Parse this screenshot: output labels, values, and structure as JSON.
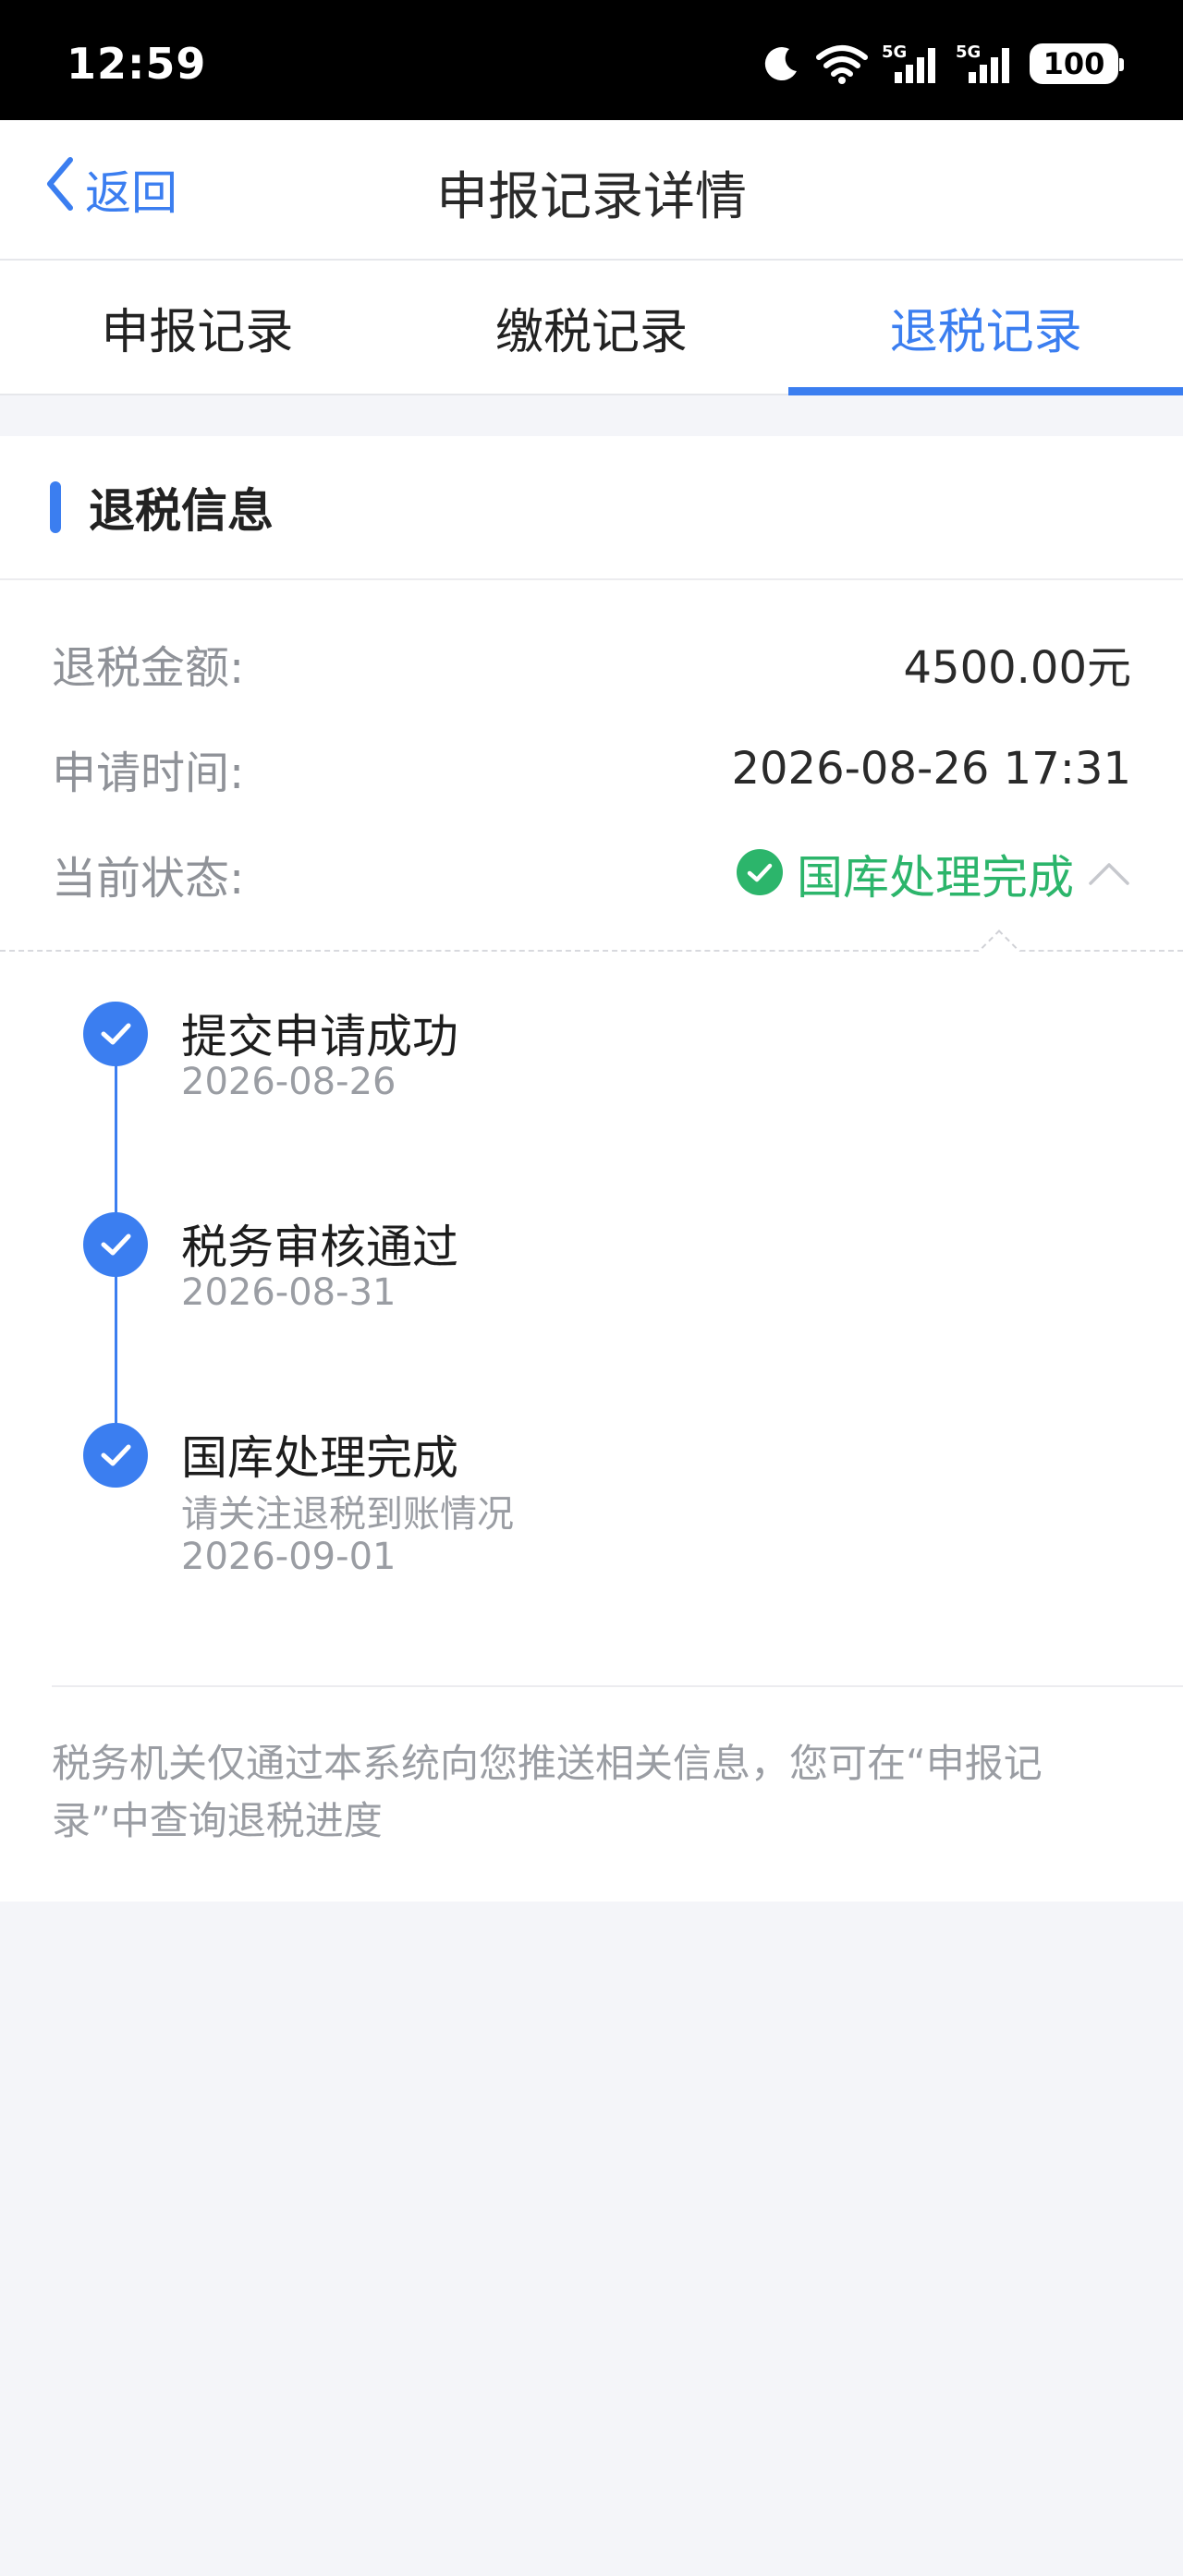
{
  "status_bar": {
    "time": "12:59",
    "icons": [
      "moon-icon",
      "wifi-icon",
      "signal-5g-icon",
      "signal-5g-icon"
    ],
    "battery": "100"
  },
  "header": {
    "back_label": "返回",
    "title": "申报记录详情"
  },
  "tabs": [
    {
      "label": "申报记录",
      "active": false
    },
    {
      "label": "缴税记录",
      "active": false
    },
    {
      "label": "退税记录",
      "active": true
    }
  ],
  "refund_info": {
    "section_title": "退税信息",
    "amount_label": "退税金额:",
    "amount_value": "4500.00元",
    "time_label": "申请时间:",
    "time_value": "2026-08-26 17:31",
    "status_label": "当前状态:",
    "status_value": "国库处理完成",
    "status_color": "#2cb56b"
  },
  "timeline": [
    {
      "title": "提交申请成功",
      "note": "",
      "date": "2026-08-26"
    },
    {
      "title": "税务审核通过",
      "note": "",
      "date": "2026-08-31"
    },
    {
      "title": "国库处理完成",
      "note": "请关注退税到账情况",
      "date": "2026-09-01"
    }
  ],
  "footer_note": "税务机关仅通过本系统向您推送相关信息，您可在“申报记录”中查询退税进度",
  "colors": {
    "accent": "#3b7ef0",
    "success": "#2cb56b"
  }
}
